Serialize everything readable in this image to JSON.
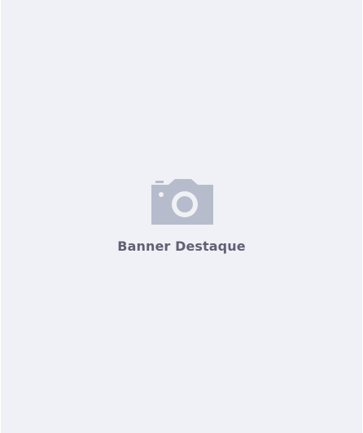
{
  "banner": {
    "label": "Banner Destaque",
    "icon": "camera-icon",
    "background_color": "#f0f1f6",
    "icon_color": "#b6bccb",
    "text_color": "#5f6173"
  }
}
